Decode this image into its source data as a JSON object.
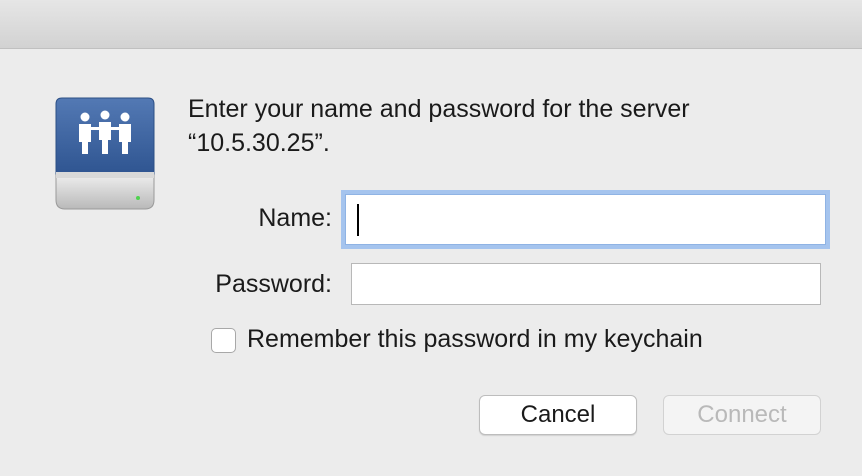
{
  "dialog": {
    "message_line1": "Enter your name and password for the server",
    "message_line2": "“10.5.30.25”.",
    "icon": "server-share-icon"
  },
  "form": {
    "name_label": "Name:",
    "name_value": "",
    "password_label": "Password:",
    "password_value": "",
    "remember_label": "Remember this password in my keychain",
    "remember_checked": false
  },
  "buttons": {
    "cancel": "Cancel",
    "connect": "Connect",
    "connect_enabled": false
  },
  "colors": {
    "focus_ring": "#a5c4ee",
    "icon_blue": "#3e67a6",
    "window_bg": "#ececec"
  }
}
